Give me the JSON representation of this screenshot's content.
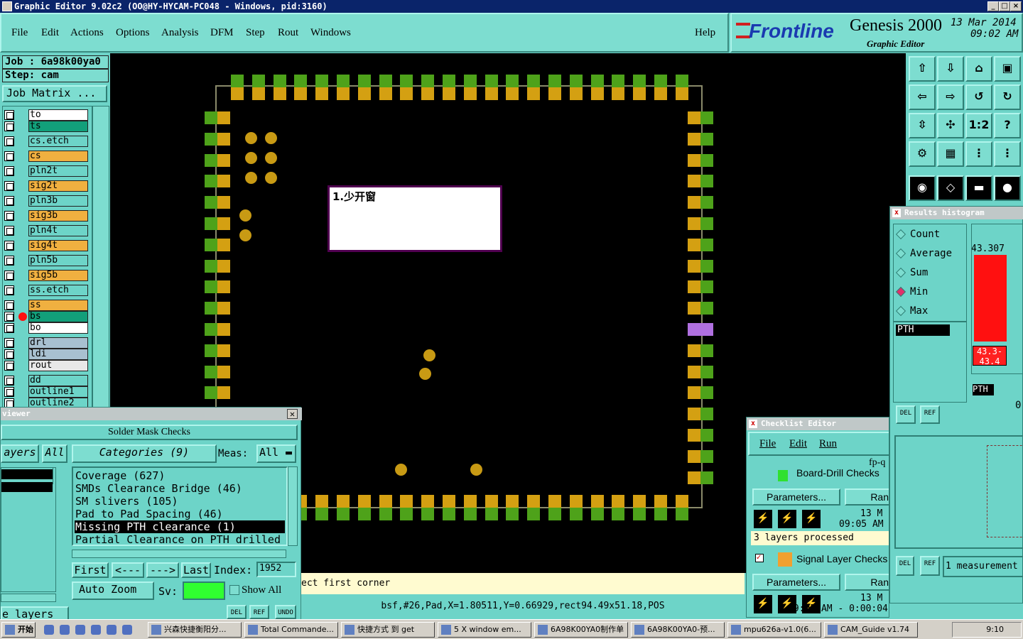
{
  "titlebar": {
    "title": "Graphic Editor 9.02c2 (OO@HY-HYCAM-PC048 - Windows, pid:3160)"
  },
  "menu": [
    "File",
    "Edit",
    "Actions",
    "Options",
    "Analysis",
    "DFM",
    "Step",
    "Rout",
    "Windows"
  ],
  "menu_help": "Help",
  "logo": {
    "brand": "Frontline",
    "product": "Genesis 2000",
    "sub": "Graphic Editor",
    "date": "13 Mar 2014",
    "time": "09:02 AM"
  },
  "job": {
    "job": "Job : 6a98k00ya0",
    "step": "Step: cam",
    "matrix": "Job Matrix ..."
  },
  "layers": [
    {
      "name": "to",
      "c": "c-w"
    },
    {
      "name": "ts",
      "c": "c-g"
    },
    {
      "name": "cs.etch",
      "c": "c-t"
    },
    {
      "name": "cs",
      "c": "c-o"
    },
    {
      "name": "pln2t",
      "c": "c-t"
    },
    {
      "name": "sig2t",
      "c": "c-o"
    },
    {
      "name": "pln3b",
      "c": "c-t"
    },
    {
      "name": "sig3b",
      "c": "c-o"
    },
    {
      "name": "pln4t",
      "c": "c-t"
    },
    {
      "name": "sig4t",
      "c": "c-o"
    },
    {
      "name": "pln5b",
      "c": "c-t"
    },
    {
      "name": "sig5b",
      "c": "c-o"
    },
    {
      "name": "ss.etch",
      "c": "c-t"
    },
    {
      "name": "ss",
      "c": "c-o"
    },
    {
      "name": "bs",
      "c": "c-g"
    },
    {
      "name": "bo",
      "c": "c-w"
    },
    {
      "name": "drl",
      "c": "c-b"
    },
    {
      "name": "ldi",
      "c": "c-b"
    },
    {
      "name": "rout",
      "c": "c-l"
    },
    {
      "name": "dd",
      "c": "c-t"
    },
    {
      "name": "outline1",
      "c": "c-t"
    },
    {
      "name": "outline2",
      "c": "c-t"
    }
  ],
  "note": "1.少开窗",
  "viewer": {
    "title": "viewer",
    "header": "Solder Mask Checks",
    "layers_label": "ayers",
    "all": "All",
    "categories": "Categories (9)",
    "meas_label": "Meas:",
    "meas_value": "All",
    "items": [
      "Coverage (627)",
      "SMDs Clearance Bridge (46)",
      "SM slivers (105)",
      "Pad to Pad Spacing (46)",
      "Missing PTH clearance (1)",
      "Partial Clearance on PTH drilled"
    ],
    "first": "First",
    "prev": "<---",
    "next": "--->",
    "last": "Last",
    "index_label": "Index:",
    "index_value": "1952",
    "autozoom": "Auto Zoom",
    "sv": "Sv:",
    "showall": "Show All",
    "layers_btn": "e layers",
    "del": "DEL",
    "ref": "REF",
    "undo": "UNDO"
  },
  "status": {
    "msg": "ect first corner",
    "coords": "bsf,#26,Pad,X=1.80511,Y=0.66929,rect94.49x51.18,POS"
  },
  "tools": [
    "⇧",
    "⇩",
    "⌂",
    "▣",
    "⇦",
    "⇨",
    "↺",
    "↻",
    "⇳",
    "✣",
    "1:2",
    "?",
    "⚙",
    "▦",
    "⋮",
    "⋮",
    "◉",
    "◇",
    "▬",
    "●"
  ],
  "hist": {
    "title": "Results histogram",
    "opts": [
      "Count",
      "Average",
      "Sum",
      "Min",
      "Max"
    ],
    "selected": "Min",
    "filter": "PTH",
    "value": "43.307",
    "range": "43.3-43.4",
    "filter2": "PTH",
    "zero": "0.",
    "del": "DEL",
    "ref": "REF",
    "meas": "1 measurement"
  },
  "checklist": {
    "title": "Checklist Editor",
    "menu": [
      "File",
      "Edit",
      "Run"
    ],
    "fp": "fp-q",
    "c1": "Board-Drill Checks",
    "params": "Parameters...",
    "run": "Ran",
    "date1": "13 M",
    "time1": "09:05 AM",
    "processed": "3 layers processed",
    "c2": "Signal Layer Checks",
    "date2": "13 M",
    "time2": "09:05 AM - 0:00:04"
  },
  "taskbar": {
    "start": "开始",
    "tasks": [
      "兴森快捷衡阳分...",
      "Total Commande...",
      "快捷方式 到 get",
      "5 X window em...",
      "6A98K00YA0制作单",
      "6A98K00YA0-预...",
      "mpu626a-v1.0(6...",
      "CAM_Guide v1.74"
    ],
    "clock": "9:10"
  }
}
